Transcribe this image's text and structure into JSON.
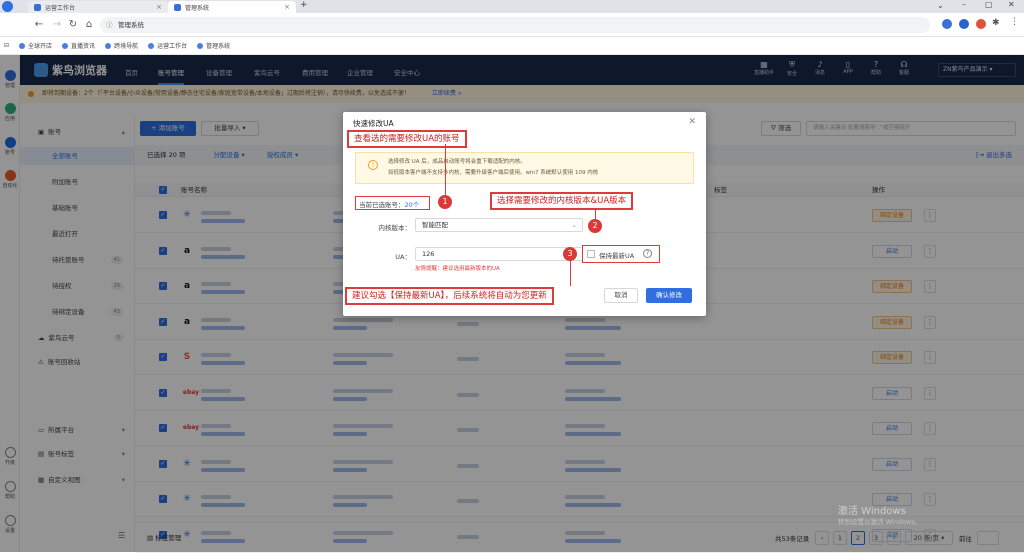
{
  "browser": {
    "tabs": [
      {
        "label": "运营工作台"
      },
      {
        "label": "管理系统"
      }
    ],
    "new_tab": "+",
    "address": "管理系统",
    "bookmarks": [
      "全球开店",
      "直播资讯",
      "跨境导航",
      "运营工作台",
      "管理系统"
    ]
  },
  "rail": {
    "items": [
      {
        "label": "管理",
        "color": "#2f6fe0"
      },
      {
        "label": "应用",
        "color": "#2fb07a"
      },
      {
        "label": "账号",
        "color": "#1a6be0"
      },
      {
        "label": "自动化",
        "color": "#e85a2a"
      },
      {
        "label": "升级",
        "color": "#888888"
      },
      {
        "label": "帮助",
        "color": "#888888"
      },
      {
        "label": "设置",
        "color": "#888888"
      }
    ]
  },
  "header": {
    "brand": "紫鸟浏览器",
    "nav": [
      "首页",
      "账号管理",
      "设备管理",
      "紫鸟云号",
      "费用管理",
      "企业管理",
      "安全中心"
    ],
    "active_nav": "账号管理",
    "icons": [
      {
        "label": "直播助手",
        "icon": "shop-icon"
      },
      {
        "label": "安全",
        "icon": "shield-icon"
      },
      {
        "label": "消息",
        "icon": "bell-icon"
      },
      {
        "label": "APP",
        "icon": "phone-icon"
      },
      {
        "label": "帮助",
        "icon": "help-icon"
      },
      {
        "label": "客服",
        "icon": "headset-icon"
      }
    ],
    "user": "ZN紫鸟产品演示"
  },
  "notice": {
    "text": "即将到期设备：2个（「平台设备/小众设备/常用设备/静态住宅设备/家庭宽带设备/本地设备」过期后将注销），请尽快续费，以免造成不便！",
    "link": "立即续费 »"
  },
  "sidebar": {
    "group_title": "账号",
    "items": [
      {
        "label": "全部账号",
        "count": ""
      },
      {
        "label": "附加账号",
        "count": ""
      },
      {
        "label": "基础账号",
        "count": ""
      },
      {
        "label": "最近打开",
        "count": ""
      },
      {
        "label": "待托管账号",
        "count": "41"
      },
      {
        "label": "待授权",
        "count": "29"
      },
      {
        "label": "待绑定设备",
        "count": "43"
      }
    ],
    "extra": [
      {
        "label": "紫鸟云号",
        "count": "5"
      },
      {
        "label": "账号回收站",
        "count": ""
      }
    ],
    "bottom": [
      "所属平台",
      "账号标签",
      "自定义视图"
    ]
  },
  "toolbar": {
    "add": "+ 添加账号",
    "batch_import": "批量导入",
    "filter": "筛选",
    "search_placeholder": "请输入关键词 批量搜索用“,”或空格隔开"
  },
  "selection_bar": {
    "selected": "已选择 20 项",
    "assign_device": "分配设备",
    "authorize": "授权成员",
    "exit_multi": "退出多选"
  },
  "table": {
    "col_name": "账号名称",
    "col_tag": "标签",
    "col_action": "操作",
    "rows": [
      {
        "platform": "Walmart",
        "logo": "✳",
        "logo_color": "#1a6be0",
        "action": "绑定设备"
      },
      {
        "platform": "Amazon",
        "logo": "a",
        "logo_color": "#111111",
        "action": "启动"
      },
      {
        "platform": "Amazon",
        "logo": "a",
        "logo_color": "#111111",
        "action": "绑定设备"
      },
      {
        "platform": "Amazon",
        "logo": "a",
        "logo_color": "#111111",
        "action": "绑定设备"
      },
      {
        "platform": "Shopee",
        "logo": "S",
        "logo_color": "#ee5a2a",
        "action": "绑定设备"
      },
      {
        "platform": "eBay",
        "logo": "ebay",
        "logo_color": "#e53238",
        "action": "启动"
      },
      {
        "platform": "eBay",
        "logo": "ebay",
        "logo_color": "#e53238",
        "action": "启动"
      },
      {
        "platform": "Walmart",
        "logo": "✳",
        "logo_color": "#1a6be0",
        "action": "启动"
      },
      {
        "platform": "Walmart",
        "logo": "✳",
        "logo_color": "#1a6be0",
        "action": "启动"
      },
      {
        "platform": "Walmart",
        "logo": "✳",
        "logo_color": "#1a6be0",
        "action": "启动"
      }
    ]
  },
  "pager": {
    "bottom_left": "标签管理",
    "total": "共53条记录",
    "pages": [
      "1",
      "2",
      "3"
    ],
    "current": "2",
    "per_page": "20 条/页",
    "goto": "前往"
  },
  "modal": {
    "title": "快速修改UA",
    "tip_line1": "选择修改 UA 后，成品启动账号将会重下载适配的内核。",
    "tip_line2": "如低版本客户端不支持多内核，需要升级客户端后使用。win7 系统默认使用 109 内核",
    "selected_label": "当前已选账号：",
    "selected_value": "20个",
    "kernel_label": "内核版本：",
    "kernel_value": "智能匹配",
    "ua_label": "UA：",
    "ua_value": "126",
    "keep_latest": "保持最新UA",
    "hint": "友情提醒：建议选用最新版本的UA",
    "cancel": "取消",
    "confirm": "确认修改"
  },
  "annotations": {
    "a1": "查看选的需要修改UA的账号",
    "a2": "选择需要修改的内核版本&UA版本",
    "a3": "建议勾选【保持最新UA】，后续系统将自动为您更新",
    "n1": "1",
    "n2": "2",
    "n3": "3"
  },
  "watermark": {
    "line1": "激活 Windows",
    "line2": "转到设置以激活 Windows。"
  }
}
